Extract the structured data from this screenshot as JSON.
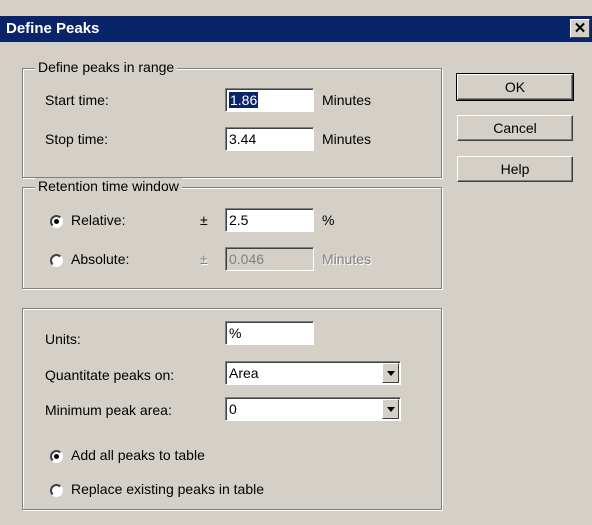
{
  "window": {
    "title": "Define Peaks",
    "close_glyph": "✕"
  },
  "range_group": {
    "legend": "Define peaks in range",
    "start_label": "Start time:",
    "start_value": "1.86",
    "start_unit": "Minutes",
    "stop_label": "Stop time:",
    "stop_value": "3.44",
    "stop_unit": "Minutes"
  },
  "window_group": {
    "legend": "Retention time window",
    "relative_label": "Relative:",
    "relative_pm": "±",
    "relative_value": "2.5",
    "relative_unit": "%",
    "absolute_label": "Absolute:",
    "absolute_pm": "±",
    "absolute_value": "0.046",
    "absolute_unit": "Minutes",
    "selected": "relative"
  },
  "quant_group": {
    "units_label": "Units:",
    "units_value": "%",
    "quantitate_label": "Quantitate peaks on:",
    "quantitate_value": "Area",
    "min_area_label": "Minimum peak area:",
    "min_area_value": "0",
    "add_all_label": "Add all peaks to table",
    "replace_label": "Replace existing peaks in table",
    "selected": "add_all"
  },
  "buttons": {
    "ok": "OK",
    "cancel": "Cancel",
    "help": "Help"
  },
  "colors": {
    "face": "#d4d0c8",
    "title_bar": "#0a246a",
    "selection": "#0a246a"
  }
}
